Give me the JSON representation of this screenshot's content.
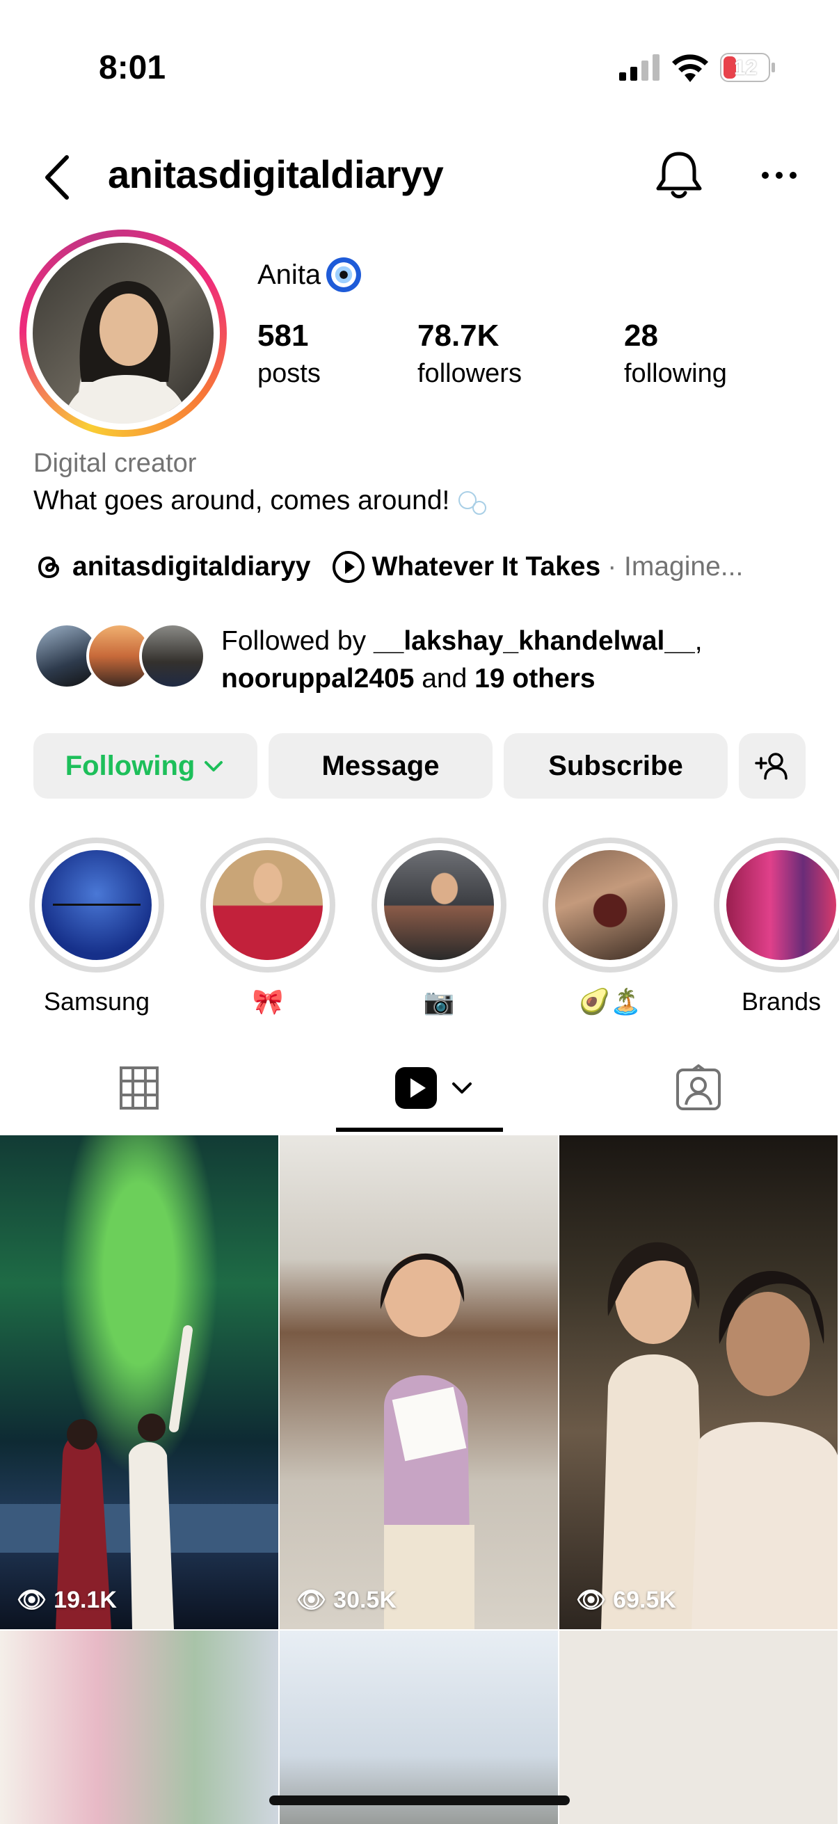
{
  "status_bar": {
    "time": "8:01",
    "battery": "12"
  },
  "header": {
    "username": "anitasdigitaldiaryy"
  },
  "profile": {
    "display_name": "Anita",
    "stats": [
      {
        "value": "581",
        "label": "posts"
      },
      {
        "value": "78.7K",
        "label": "followers"
      },
      {
        "value": "28",
        "label": "following"
      }
    ],
    "category": "Digital creator",
    "bio": "What goes around, comes around!",
    "threads_handle": "anitasdigitaldiaryy",
    "music_title": "Whatever It Takes",
    "music_artist": "· Imagine..."
  },
  "followed_by": {
    "prefix": "Followed by ",
    "user1": "__lakshay_khandelwal__",
    "comma": ",",
    "user2": "nooruppal2405",
    "and": " and ",
    "others": "19 others"
  },
  "actions": {
    "following": "Following",
    "message": "Message",
    "subscribe": "Subscribe"
  },
  "highlights": [
    {
      "label": "Samsung"
    },
    {
      "label": "🎀"
    },
    {
      "label": "📷"
    },
    {
      "label": "🥑🏝️"
    },
    {
      "label": "Brands"
    }
  ],
  "reels": [
    {
      "views": "19.1K"
    },
    {
      "views": "30.5K"
    },
    {
      "views": "69.5K"
    }
  ],
  "colors": {
    "following_green": "#1dbf5a",
    "button_bg": "#efefef",
    "secondary_text": "#737373"
  }
}
